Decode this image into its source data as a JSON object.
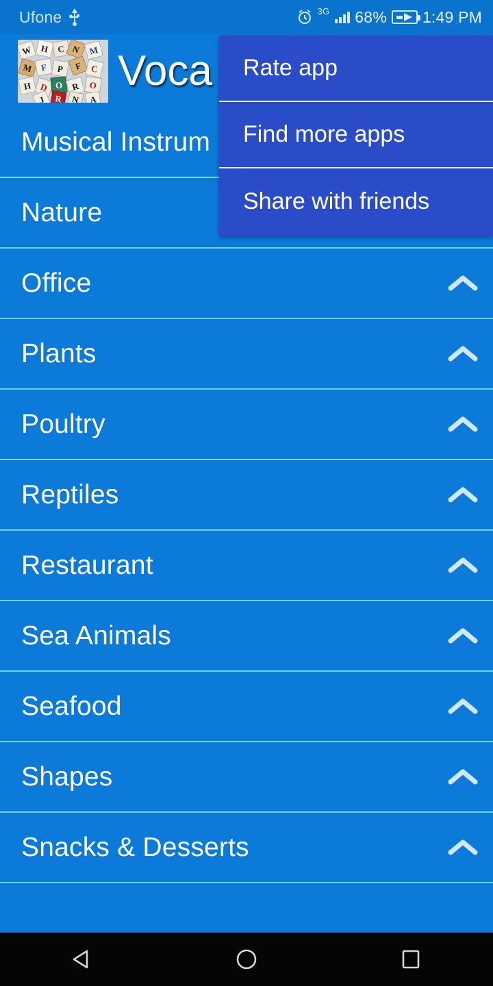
{
  "status_bar": {
    "carrier": "Ufone",
    "usb_icon": "usb-icon",
    "alarm_icon": "alarm-clock-icon",
    "network_type": "3G",
    "signal_icon": "signal-bars-icon",
    "battery_percent": "68%",
    "battery_icon": "battery-charging-icon",
    "time": "1:49 PM",
    "background_color": "#0a73cd",
    "text_color": "#cfe6fa"
  },
  "action_bar": {
    "logo_icon": "letter-dice-logo",
    "title": "Voca",
    "background_color": "#0b7ad8",
    "title_color": "#ffffff"
  },
  "overflow_menu": {
    "background_color": "#2a4cc8",
    "divider_color": "#e8ecf7",
    "items": [
      {
        "label": "Rate app"
      },
      {
        "label": "Find more apps"
      },
      {
        "label": "Share with friends"
      }
    ]
  },
  "list": {
    "background_color": "#0b7ad8",
    "divider_color": "#6fd5d8",
    "row_text_color": "#ffffff",
    "chevron_icon": "chevron-up-icon",
    "items": [
      {
        "label": "Musical Instrum",
        "chevron": false
      },
      {
        "label": "Nature",
        "chevron": false
      },
      {
        "label": "Office",
        "chevron": true
      },
      {
        "label": "Plants",
        "chevron": true
      },
      {
        "label": "Poultry",
        "chevron": true
      },
      {
        "label": "Reptiles",
        "chevron": true
      },
      {
        "label": "Restaurant",
        "chevron": true
      },
      {
        "label": "Sea Animals",
        "chevron": true
      },
      {
        "label": "Seafood",
        "chevron": true
      },
      {
        "label": "Shapes",
        "chevron": true
      },
      {
        "label": "Snacks & Desserts",
        "chevron": true
      }
    ]
  },
  "nav_bar": {
    "background_color": "#050505",
    "back_icon": "back-triangle-icon",
    "home_icon": "home-circle-icon",
    "recents_icon": "recents-square-icon"
  }
}
